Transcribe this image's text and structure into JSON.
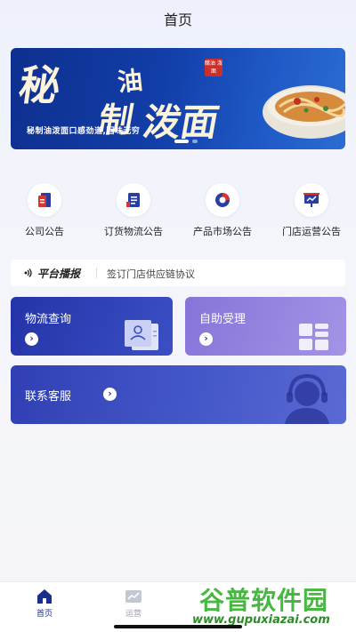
{
  "header": {
    "title": "首页"
  },
  "banner": {
    "title_parts": [
      "秘",
      "油",
      "制",
      "泼面"
    ],
    "seal": "醋油 泼面",
    "slogan": "秘制油泼面口感劲道,回味无穷"
  },
  "notices": [
    {
      "label": "公司公告",
      "icon": "document-icon"
    },
    {
      "label": "订货物流公告",
      "icon": "list-document-icon"
    },
    {
      "label": "产品市场公告",
      "icon": "pie-chart-icon"
    },
    {
      "label": "门店运营公告",
      "icon": "presentation-chart-icon"
    }
  ],
  "broadcast": {
    "title": "平台播报",
    "text": "签订门店供应链协议"
  },
  "cards": {
    "logistics": "物流查询",
    "self_service": "自助受理",
    "customer_service": "联系客服"
  },
  "tabbar": {
    "home": "首页",
    "operations": "运营"
  },
  "watermark": {
    "name": "谷普软件园",
    "url": "www.gupuxiazai.com"
  },
  "colors": {
    "accent": "#2433a8",
    "active_tab": "#1a2f8a",
    "icon_red": "#d9352c",
    "icon_blue": "#2a3ea0"
  }
}
